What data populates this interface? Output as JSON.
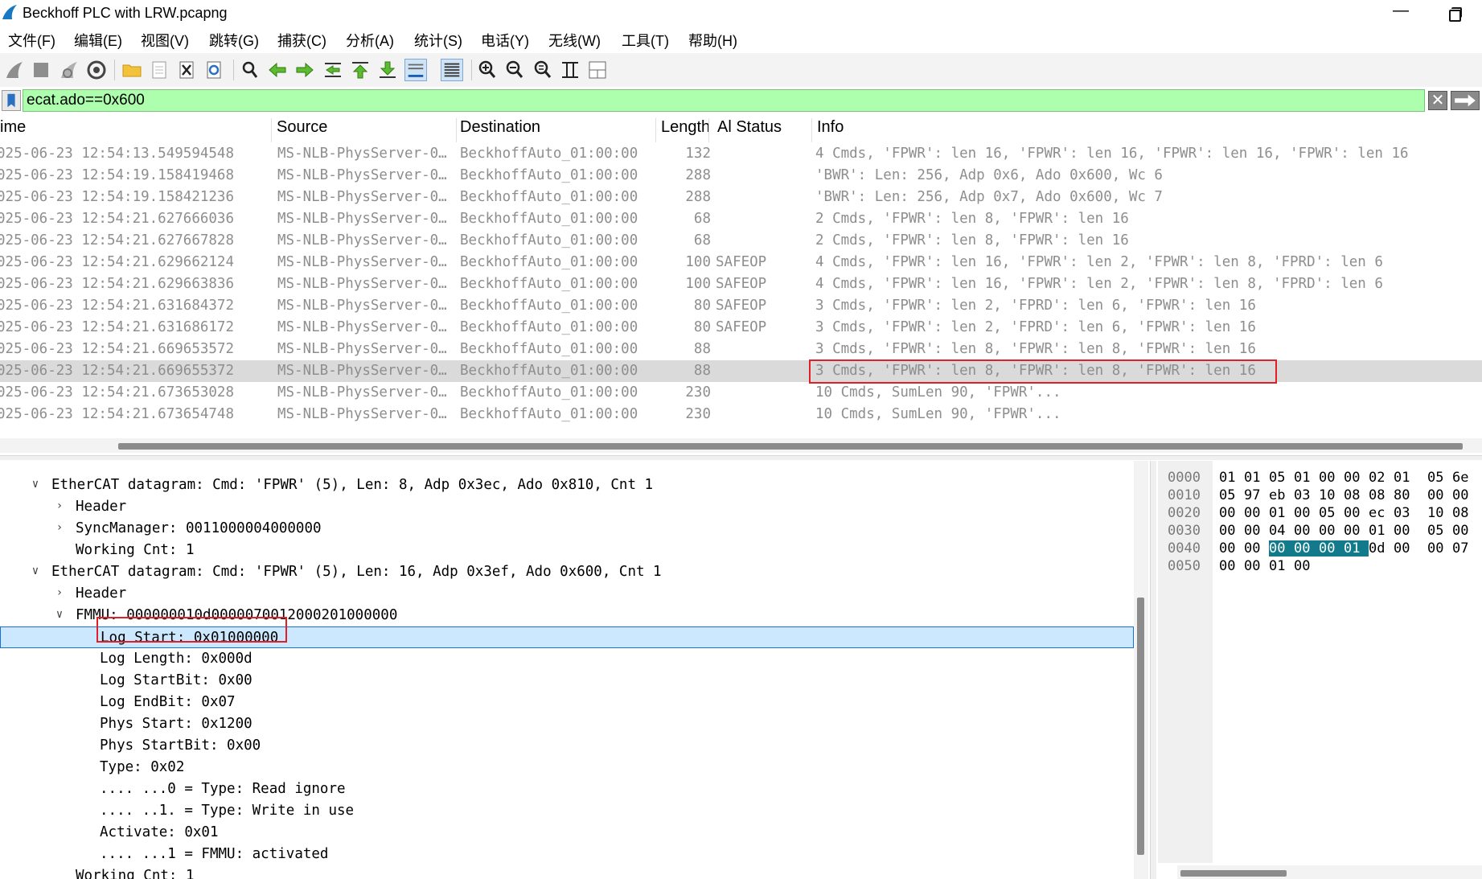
{
  "window": {
    "title": "Beckhoff PLC with LRW.pcapng",
    "minimize_glyph": "—"
  },
  "menu": [
    "文件(F)",
    "编辑(E)",
    "视图(V)",
    "跳转(G)",
    "捕获(C)",
    "分析(A)",
    "统计(S)",
    "电话(Y)",
    "无线(W)",
    "工具(T)",
    "帮助(H)"
  ],
  "toolbar": {
    "icons": [
      "shark-fin-start-icon",
      "stop-capture-icon",
      "restart-capture-icon",
      "capture-options-icon",
      "open-folder-icon",
      "save-file-icon",
      "close-file-icon",
      "reload-file-icon",
      "find-packet-icon",
      "go-back-icon",
      "go-forward-icon",
      "go-to-packet-icon",
      "first-packet-icon",
      "last-packet-icon",
      "auto-scroll-icon",
      "colorize-icon",
      "zoom-in-icon",
      "zoom-out-icon",
      "normal-size-icon",
      "resize-columns-icon",
      "layout-icon"
    ],
    "pressed": [
      "auto-scroll-icon",
      "colorize-icon"
    ]
  },
  "filter": {
    "value": "ecat.ado==0x600",
    "clear_glyph": "✕",
    "apply_glyph": "➡"
  },
  "packet_list": {
    "columns": [
      "ime",
      "Source",
      "Destination",
      "Length",
      "Al Status",
      "Info"
    ],
    "rows": [
      {
        "time": "025-06-23 12:54:13.549594548",
        "source": "MS-NLB-PhysServer-0…",
        "destination": "BeckhoffAuto_01:00:00",
        "length": "132",
        "al_status": "",
        "info": "4 Cmds, 'FPWR': len 16, 'FPWR': len 16, 'FPWR': len 16, 'FPWR': len 16"
      },
      {
        "time": "025-06-23 12:54:19.158419468",
        "source": "MS-NLB-PhysServer-0…",
        "destination": "BeckhoffAuto_01:00:00",
        "length": "288",
        "al_status": "",
        "info": "'BWR': Len: 256, Adp 0x6, Ado 0x600, Wc 6"
      },
      {
        "time": "025-06-23 12:54:19.158421236",
        "source": "MS-NLB-PhysServer-0…",
        "destination": "BeckhoffAuto_01:00:00",
        "length": "288",
        "al_status": "",
        "info": "'BWR': Len: 256, Adp 0x7, Ado 0x600, Wc 7"
      },
      {
        "time": "025-06-23 12:54:21.627666036",
        "source": "MS-NLB-PhysServer-0…",
        "destination": "BeckhoffAuto_01:00:00",
        "length": "68",
        "al_status": "",
        "info": "2 Cmds, 'FPWR': len 8, 'FPWR': len 16"
      },
      {
        "time": "025-06-23 12:54:21.627667828",
        "source": "MS-NLB-PhysServer-0…",
        "destination": "BeckhoffAuto_01:00:00",
        "length": "68",
        "al_status": "",
        "info": "2 Cmds, 'FPWR': len 8, 'FPWR': len 16"
      },
      {
        "time": "025-06-23 12:54:21.629662124",
        "source": "MS-NLB-PhysServer-0…",
        "destination": "BeckhoffAuto_01:00:00",
        "length": "100",
        "al_status": "SAFEOP",
        "info": "4 Cmds, 'FPWR': len 16, 'FPWR': len 2, 'FPWR': len 8, 'FPRD': len 6"
      },
      {
        "time": "025-06-23 12:54:21.629663836",
        "source": "MS-NLB-PhysServer-0…",
        "destination": "BeckhoffAuto_01:00:00",
        "length": "100",
        "al_status": "SAFEOP",
        "info": "4 Cmds, 'FPWR': len 16, 'FPWR': len 2, 'FPWR': len 8, 'FPRD': len 6"
      },
      {
        "time": "025-06-23 12:54:21.631684372",
        "source": "MS-NLB-PhysServer-0…",
        "destination": "BeckhoffAuto_01:00:00",
        "length": "80",
        "al_status": "SAFEOP",
        "info": "3 Cmds, 'FPWR': len 2, 'FPRD': len 6, 'FPWR': len 16"
      },
      {
        "time": "025-06-23 12:54:21.631686172",
        "source": "MS-NLB-PhysServer-0…",
        "destination": "BeckhoffAuto_01:00:00",
        "length": "80",
        "al_status": "SAFEOP",
        "info": "3 Cmds, 'FPWR': len 2, 'FPRD': len 6, 'FPWR': len 16"
      },
      {
        "time": "025-06-23 12:54:21.669653572",
        "source": "MS-NLB-PhysServer-0…",
        "destination": "BeckhoffAuto_01:00:00",
        "length": "88",
        "al_status": "",
        "info": "3 Cmds, 'FPWR': len 8, 'FPWR': len 8, 'FPWR': len 16"
      },
      {
        "time": "025-06-23 12:54:21.669655372",
        "source": "MS-NLB-PhysServer-0…",
        "destination": "BeckhoffAuto_01:00:00",
        "length": "88",
        "al_status": "",
        "info": "3 Cmds, 'FPWR': len 8, 'FPWR': len 8, 'FPWR': len 16",
        "selected": true
      },
      {
        "time": "025-06-23 12:54:21.673653028",
        "source": "MS-NLB-PhysServer-0…",
        "destination": "BeckhoffAuto_01:00:00",
        "length": "230",
        "al_status": "",
        "info": "10 Cmds, SumLen 90, 'FPWR'..."
      },
      {
        "time": "025-06-23 12:54:21.673654748",
        "source": "MS-NLB-PhysServer-0…",
        "destination": "BeckhoffAuto_01:00:00",
        "length": "230",
        "al_status": "",
        "info": "10 Cmds, SumLen 90, 'FPWR'..."
      }
    ]
  },
  "details": {
    "rows": [
      {
        "toggle": "∨",
        "text": "EtherCAT datagram: Cmd: 'FPWR' (5), Len: 8, Adp 0x3ec, Ado 0x810, Cnt 1"
      },
      {
        "toggle": "›",
        "text": "Header"
      },
      {
        "toggle": "›",
        "text": "SyncManager: 0011000004000000"
      },
      {
        "toggle": "",
        "text": "Working Cnt: 1"
      },
      {
        "toggle": "∨",
        "text": "EtherCAT datagram: Cmd: 'FPWR' (5), Len: 16, Adp 0x3ef, Ado 0x600, Cnt 1"
      },
      {
        "toggle": "›",
        "text": "Header"
      },
      {
        "toggle": "∨",
        "text": "FMMU: 000000010d0000070012000201000000"
      },
      {
        "toggle": "",
        "text": "Log Start: 0x01000000",
        "selected": true
      },
      {
        "toggle": "",
        "text": "Log Length: 0x000d"
      },
      {
        "toggle": "",
        "text": "Log StartBit: 0x00"
      },
      {
        "toggle": "",
        "text": "Log EndBit: 0x07"
      },
      {
        "toggle": "",
        "text": "Phys Start: 0x1200"
      },
      {
        "toggle": "",
        "text": "Phys StartBit: 0x00"
      },
      {
        "toggle": "",
        "text": "Type: 0x02"
      },
      {
        "toggle": "",
        "text": ".... ...0 = Type: Read ignore"
      },
      {
        "toggle": "",
        "text": ".... ..1. = Type: Write in use"
      },
      {
        "toggle": "",
        "text": "Activate: 0x01"
      },
      {
        "toggle": "",
        "text": ".... ...1 = FMMU: activated"
      },
      {
        "toggle": "",
        "text": "Working Cnt: 1"
      }
    ]
  },
  "bytes": {
    "rows": [
      {
        "offset": "0000",
        "bytes": [
          "01",
          "01",
          "05",
          "01",
          "00",
          "00",
          "02",
          "01",
          "05",
          "6e"
        ]
      },
      {
        "offset": "0010",
        "bytes": [
          "05",
          "97",
          "eb",
          "03",
          "10",
          "08",
          "08",
          "80",
          "00",
          "00"
        ]
      },
      {
        "offset": "0020",
        "bytes": [
          "00",
          "00",
          "01",
          "00",
          "05",
          "00",
          "ec",
          "03",
          "10",
          "08"
        ]
      },
      {
        "offset": "0030",
        "bytes": [
          "00",
          "00",
          "04",
          "00",
          "00",
          "00",
          "01",
          "00",
          "05",
          "00"
        ]
      },
      {
        "offset": "0040",
        "bytes": [
          "00",
          "00",
          "00",
          "00",
          "00",
          "01",
          "0d",
          "00",
          "00",
          "07"
        ]
      },
      {
        "offset": "0050",
        "bytes": [
          "00",
          "00",
          "01",
          "00"
        ]
      }
    ],
    "highlight": {
      "row": 4,
      "from": 2,
      "to": 5
    }
  },
  "colors": {
    "filter_valid_bg": "#adffad",
    "selected_packet_bg": "#dadada",
    "selected_field_bg": "#cce8ff",
    "byte_highlight_bg": "#137a8c",
    "annotation_red": "#e01f26"
  }
}
